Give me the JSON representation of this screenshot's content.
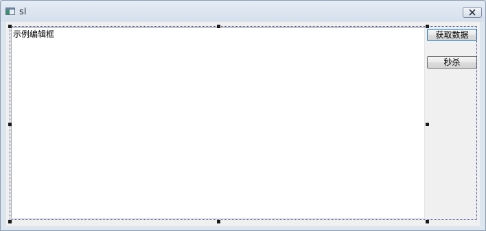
{
  "window": {
    "title": "sl"
  },
  "editor": {
    "text": "示例编辑框"
  },
  "buttons": {
    "get_data_label": "获取数据",
    "seckill_label": "秒杀"
  },
  "icons": {
    "app": "app-window-icon",
    "close": "close-icon"
  }
}
